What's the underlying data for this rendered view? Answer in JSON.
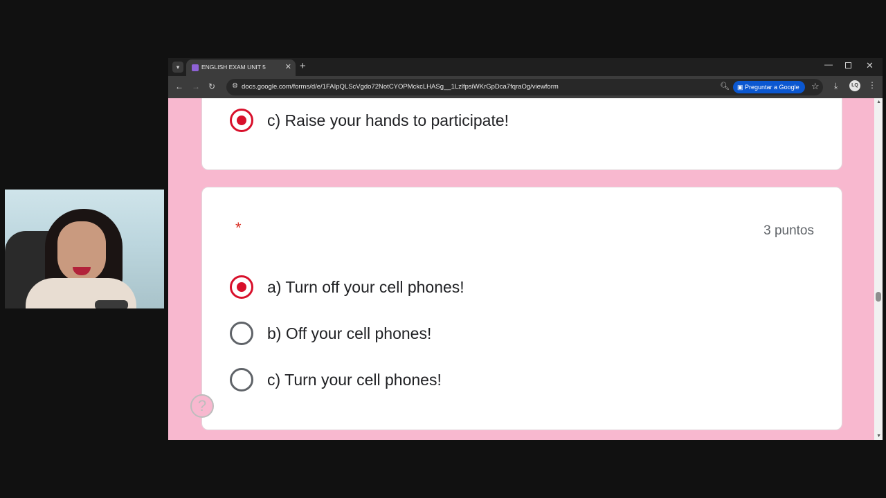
{
  "tab": {
    "title": "ENGLISH EXAM UNIT 5"
  },
  "toolbar": {
    "url": "docs.google.com/forms/d/e/1FAIpQLScVgdo72NotCYOPMckcLHASg__1LzlfpsiWKrGpDca7fqraOg/viewform",
    "lens_label": "Preguntar a Google",
    "profile_initials": "LQ"
  },
  "icons": {
    "dropdown": "chevron-down-icon",
    "back": "back-arrow-icon",
    "forward": "forward-arrow-icon",
    "reload": "reload-icon",
    "site_info": "tune-icon",
    "zoom": "zoom-icon",
    "star": "star-icon",
    "download": "download-icon",
    "menu": "kebab-menu-icon",
    "help": "help-icon"
  },
  "form": {
    "previous_option": {
      "label": "c) Raise your hands to participate!",
      "selected": true
    },
    "question": {
      "required_mark": "*",
      "points": "3 puntos",
      "options": [
        {
          "label": "a) Turn off your cell phones!",
          "selected": true
        },
        {
          "label": "b) Off your cell phones!",
          "selected": false
        },
        {
          "label": "c) Turn your cell phones!",
          "selected": false
        }
      ]
    }
  },
  "colors": {
    "page_background": "#f8b8cf",
    "radio_selected": "#d8102b",
    "radio_unselected": "#5f6368",
    "lens_button": "#0b57d0"
  }
}
